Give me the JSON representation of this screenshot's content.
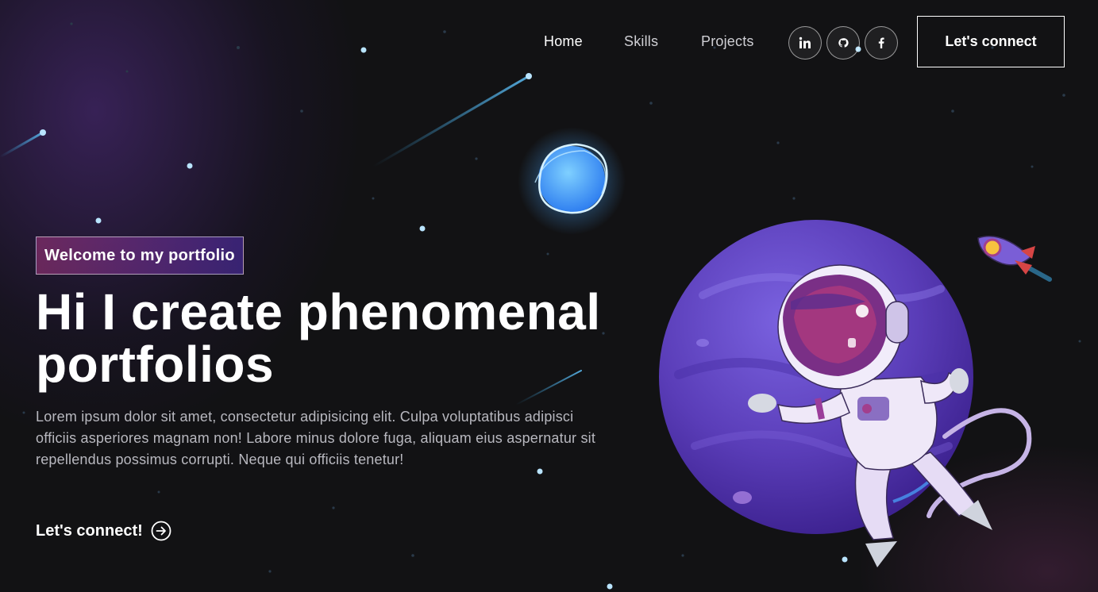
{
  "nav": {
    "links": [
      {
        "label": "Home",
        "active": true
      },
      {
        "label": "Skills",
        "active": false
      },
      {
        "label": "Projects",
        "active": false
      }
    ],
    "social_icons": [
      "linkedin-icon",
      "github-icon",
      "facebook-icon"
    ],
    "connect_label": "Let's connect"
  },
  "hero": {
    "tagline": "Welcome to my portfolio",
    "headline": "Hi I create phenomenal portfolios",
    "description": "Lorem ipsum dolor sit amet, consectetur adipisicing elit. Culpa voluptatibus adipisci officiis asperiores magnam non! Labore minus dolore fuga, aliquam eius aspernatur sit repellendus possimus corrupti. Neque qui officiis tenetur!",
    "cta_label": "Let's connect!",
    "cta_icon": "arrow-right-circle-icon"
  },
  "illustration": {
    "planet": "purple-planet",
    "character": "astronaut",
    "extras": [
      "blue-glowing-moon",
      "rocket",
      "shooting-stars"
    ]
  },
  "colors": {
    "background": "#121214",
    "tagline_gradient_start": "#aa367c",
    "tagline_gradient_end": "#4a2fbd",
    "planet": "#5b3bb5",
    "star": "#7ec8f0"
  }
}
